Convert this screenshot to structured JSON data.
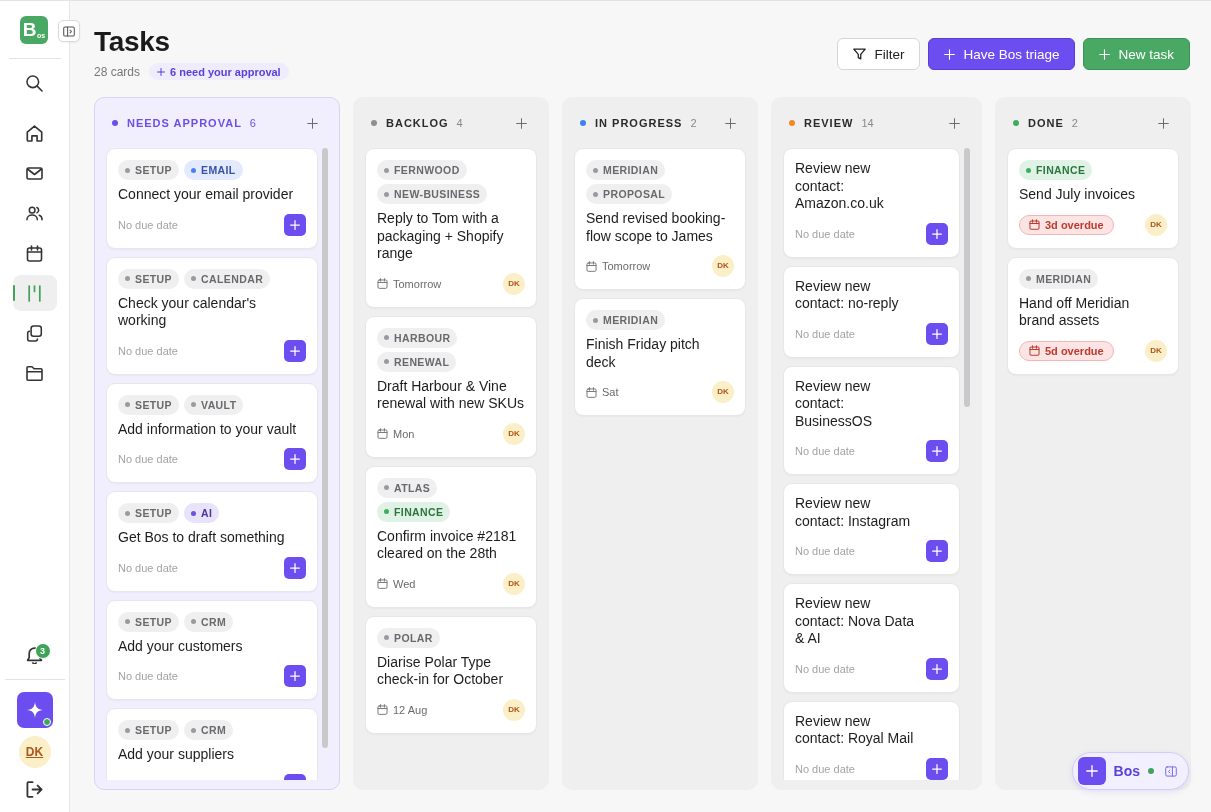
{
  "sidebar": {
    "logo": "B$_{os}$",
    "nav_items": [
      {
        "kind": "home",
        "selected": false
      },
      {
        "kind": "mail",
        "selected": false
      },
      {
        "kind": "people",
        "selected": false
      },
      {
        "kind": "calendar",
        "selected": false
      },
      {
        "kind": "board",
        "selected": true
      },
      {
        "kind": "documents",
        "selected": false
      },
      {
        "kind": "folder",
        "selected": false
      }
    ],
    "notification_count": "3",
    "assistant_online": true,
    "user_initials": "DK"
  },
  "header": {
    "title": "Tasks",
    "card_count": "28 cards",
    "approval_note": "6 need your approval",
    "buttons": [
      {
        "label": "Filter",
        "kind": "filter"
      },
      {
        "label": "Have Bos triage",
        "kind": "assistant"
      },
      {
        "label": "New task",
        "kind": "primary"
      }
    ]
  },
  "columns": [
    {
      "title": "NEEDS APPROVAL",
      "count": "6",
      "color": "#6d4ee8",
      "highlighted": true,
      "scrollbar": true,
      "cards": [
        {
          "kind": "suggestion",
          "tags": [
            {
              "label": "SETUP",
              "color": "#9a9aa0"
            },
            {
              "label": "EMAIL",
              "color": "#4f7cf0"
            }
          ],
          "title": "Connect your email provider",
          "due": {
            "kind": "none",
            "text": "No due date"
          }
        },
        {
          "kind": "suggestion",
          "tags": [
            {
              "label": "SETUP",
              "color": "#9a9aa0"
            },
            {
              "label": "CALENDAR",
              "color": "#9a9aa0"
            }
          ],
          "title": "Check your calendar's working",
          "due": {
            "kind": "none",
            "text": "No due date"
          }
        },
        {
          "kind": "suggestion",
          "tags": [
            {
              "label": "SETUP",
              "color": "#9a9aa0"
            },
            {
              "label": "VAULT",
              "color": "#9a9aa0"
            }
          ],
          "title": "Add information to your vault",
          "due": {
            "kind": "none",
            "text": "No due date"
          }
        },
        {
          "kind": "suggestion",
          "tags": [
            {
              "label": "SETUP",
              "color": "#9a9aa0"
            },
            {
              "label": "AI",
              "color": "#6d4ee8"
            }
          ],
          "title": "Get Bos to draft something",
          "due": {
            "kind": "none",
            "text": "No due date"
          }
        },
        {
          "kind": "suggestion",
          "tags": [
            {
              "label": "SETUP",
              "color": "#9a9aa0"
            },
            {
              "label": "CRM",
              "color": "#9a9aa0"
            }
          ],
          "title": "Add your customers",
          "due": {
            "kind": "none",
            "text": "No due date"
          }
        },
        {
          "kind": "suggestion",
          "tags": [
            {
              "label": "SETUP",
              "color": "#9a9aa0"
            },
            {
              "label": "CRM",
              "color": "#9a9aa0"
            }
          ],
          "title": "Add your suppliers"
        }
      ]
    },
    {
      "title": "BACKLOG",
      "count": "4",
      "color": "#8e8e93",
      "highlighted": false,
      "scrollbar": false,
      "cards": [
        {
          "kind": "task",
          "tags": [
            {
              "label": "FERNWOOD",
              "color": "#9a9aa0"
            },
            {
              "label": "NEW-BUSINESS",
              "color": "#9a9aa0"
            }
          ],
          "title": "Reply to Tom with a packaging + Shopify range",
          "due": {
            "kind": "date",
            "text": "Tomorrow"
          },
          "assignee": "DK"
        },
        {
          "kind": "task",
          "tags": [
            {
              "label": "HARBOUR",
              "color": "#9a9aa0"
            },
            {
              "label": "RENEWAL",
              "color": "#9a9aa0"
            }
          ],
          "title": "Draft Harbour & Vine renewal with new SKUs",
          "due": {
            "kind": "date",
            "text": "Mon"
          },
          "assignee": "DK"
        },
        {
          "kind": "task",
          "tags": [
            {
              "label": "ATLAS",
              "color": "#9a9aa0"
            },
            {
              "label": "FINANCE",
              "color": "#3fae5c"
            }
          ],
          "title": "Confirm invoice #2181 cleared on the 28th",
          "due": {
            "kind": "date",
            "text": "Wed"
          },
          "assignee": "DK"
        },
        {
          "kind": "task",
          "tags": [
            {
              "label": "POLAR",
              "color": "#9a9aa0"
            }
          ],
          "title": "Diarise Polar Type check-in for October",
          "due": {
            "kind": "date",
            "text": "12 Aug"
          },
          "assignee": "DK"
        }
      ]
    },
    {
      "title": "IN PROGRESS",
      "count": "2",
      "color": "#3b82f6",
      "highlighted": false,
      "scrollbar": false,
      "cards": [
        {
          "kind": "task",
          "tags": [
            {
              "label": "MERIDIAN",
              "color": "#9a9aa0"
            },
            {
              "label": "PROPOSAL",
              "color": "#9a9aa0"
            }
          ],
          "title": "Send revised booking-flow scope to James",
          "due": {
            "kind": "date",
            "text": "Tomorrow"
          },
          "assignee": "DK"
        },
        {
          "kind": "task",
          "tags": [
            {
              "label": "MERIDIAN",
              "color": "#9a9aa0"
            }
          ],
          "title": "Finish Friday pitch deck",
          "due": {
            "kind": "date",
            "text": "Sat"
          },
          "assignee": "DK"
        }
      ]
    },
    {
      "title": "REVIEW",
      "count": "14",
      "color": "#f08a24",
      "highlighted": false,
      "scrollbar": true,
      "cards": [
        {
          "kind": "suggestion",
          "title": "Review new contact: Amazon.co.uk",
          "due": {
            "kind": "none",
            "text": "No due date"
          }
        },
        {
          "kind": "suggestion",
          "title": "Review new contact: no-reply",
          "due": {
            "kind": "none",
            "text": "No due date"
          }
        },
        {
          "kind": "suggestion",
          "title": "Review new contact: BusinessOS",
          "due": {
            "kind": "none",
            "text": "No due date"
          }
        },
        {
          "kind": "suggestion",
          "title": "Review new contact: Instagram",
          "due": {
            "kind": "none",
            "text": "No due date"
          }
        },
        {
          "kind": "suggestion",
          "title": "Review new contact: Nova Data & AI",
          "due": {
            "kind": "none",
            "text": "No due date"
          }
        },
        {
          "kind": "suggestion",
          "title": "Review new contact: Royal Mail",
          "due": {
            "kind": "none",
            "text": "No due date"
          }
        }
      ]
    },
    {
      "title": "DONE",
      "count": "2",
      "color": "#3fae5c",
      "highlighted": false,
      "scrollbar": false,
      "cards": [
        {
          "kind": "task",
          "tags": [
            {
              "label": "FINANCE",
              "color": "#3fae5c"
            }
          ],
          "title": "Send July invoices",
          "due": {
            "kind": "overdue",
            "text": "3d overdue"
          },
          "assignee": "DK"
        },
        {
          "kind": "task",
          "tags": [
            {
              "label": "MERIDIAN",
              "color": "#9a9aa0"
            }
          ],
          "title": "Hand off Meridian brand assets",
          "due": {
            "kind": "overdue",
            "text": "5d overdue"
          },
          "assignee": "DK"
        }
      ]
    }
  ],
  "assistant_dock": {
    "label": "Bos",
    "online": true
  }
}
